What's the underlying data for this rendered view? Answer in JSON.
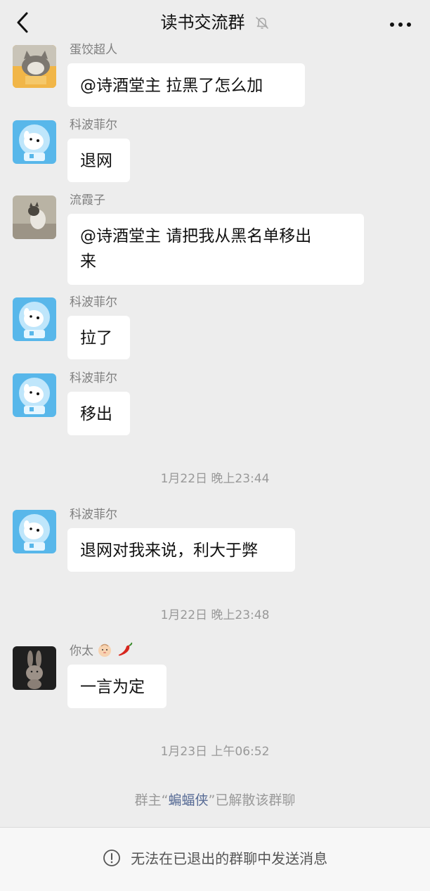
{
  "header": {
    "title": "读书交流群",
    "back_icon": "chevron-left-icon",
    "mute_icon": "bell-off-icon",
    "more_icon": "more-horizontal-icon"
  },
  "messages": [
    {
      "sender": "蛋饺超人",
      "text": "@诗酒堂主  拉黑了怎么加",
      "avatar": "cat-avatar"
    },
    {
      "sender": "科波菲尔",
      "text": "退网",
      "avatar": "astronaut-dog-avatar"
    },
    {
      "sender": "流霞子",
      "text": "@诗酒堂主  请把我从黑名单移出",
      "text2": "来",
      "avatar": "cat-photo-avatar"
    },
    {
      "sender": "科波菲尔",
      "text": "拉了",
      "avatar": "astronaut-dog-avatar"
    },
    {
      "sender": "科波菲尔",
      "text": "移出",
      "avatar": "astronaut-dog-avatar"
    },
    {
      "sender": "科波菲尔",
      "text": "退网对我来说，利大于弊",
      "avatar": "astronaut-dog-avatar"
    },
    {
      "sender": "你太",
      "text": "一言为定",
      "avatar": "rabbit-avatar",
      "sender_emojis": [
        "baby-face-emoji",
        "chili-pepper-emoji"
      ]
    }
  ],
  "timestamps": [
    "1月22日 晚上23:44",
    "1月22日 晚上23:48",
    "1月23日 上午06:52"
  ],
  "system": {
    "prefix": "群主“",
    "name": "蝙蝠侠",
    "suffix": "”已解散该群聊"
  },
  "footer": {
    "text": "无法在已退出的群聊中发送消息",
    "icon": "info-circle-icon"
  },
  "colors": {
    "background": "#ededed",
    "bubble": "#ffffff",
    "link": "#576b95"
  }
}
